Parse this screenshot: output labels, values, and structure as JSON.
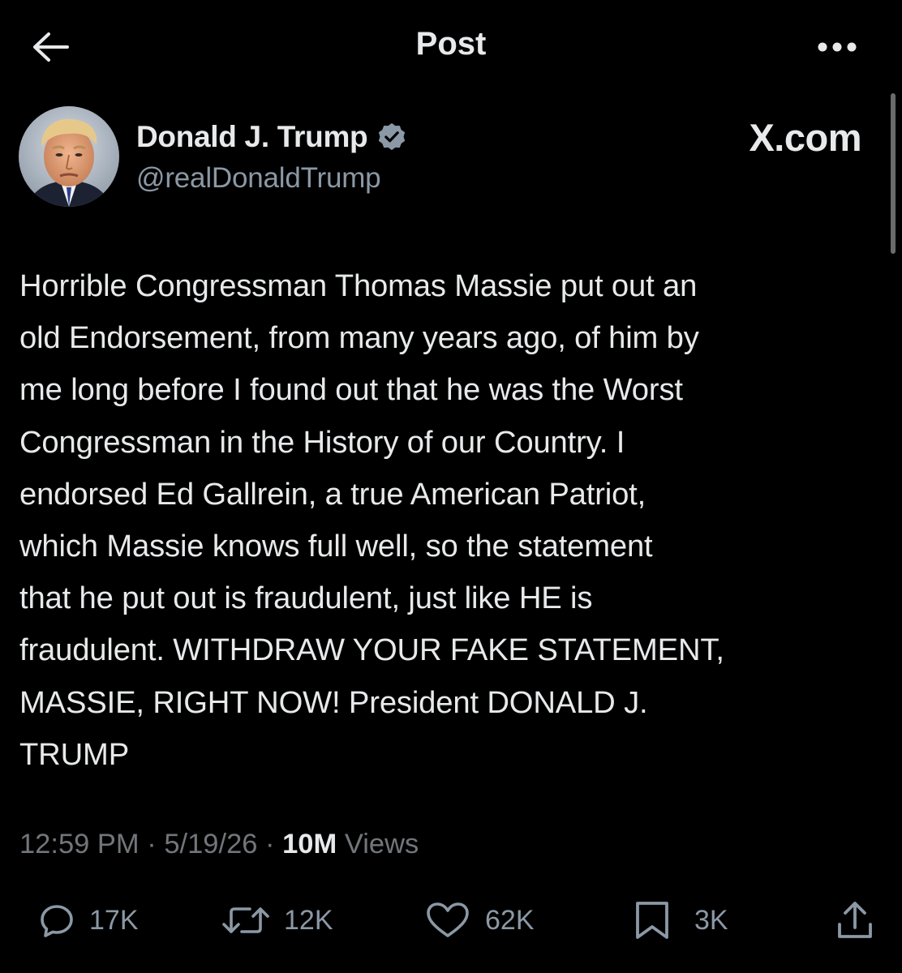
{
  "header": {
    "title": "Post"
  },
  "author": {
    "name": "Donald J. Trump",
    "handle": "@realDonaldTrump",
    "verified_color": "#8b98a5",
    "source": "X.com"
  },
  "post": {
    "lines": [
      "Horrible Congressman Thomas Massie put out an",
      "old Endorsement, from many years ago, of him by",
      "me long before I found out that he was the Worst",
      "Congressman in the History of our Country. I",
      "endorsed Ed Gallrein, a true American Patriot,",
      "which Massie knows full well, so the statement",
      "that he put out is fraudulent, just like HE is",
      "fraudulent. WITHDRAW YOUR FAKE STATEMENT,",
      "MASSIE, RIGHT NOW! President DONALD J.",
      "TRUMP"
    ],
    "time": "12:59 PM",
    "date": "5/19/26",
    "views_count": "10M",
    "views_label": "Views"
  },
  "actions": {
    "replies": "17K",
    "reposts": "12K",
    "likes": "62K",
    "bookmarks": "3K"
  },
  "icons": {
    "back": "arrow-left-icon",
    "more": "more-horizontal-icon",
    "verified": "verified-badge-icon",
    "reply": "reply-bubble-icon",
    "repost": "repost-arrows-icon",
    "like": "heart-icon",
    "bookmark": "bookmark-icon",
    "share": "share-upload-icon"
  },
  "colors": {
    "background": "#000000",
    "text": "#e7e9ea",
    "secondary": "#71767b",
    "icon": "#8b98a5"
  }
}
